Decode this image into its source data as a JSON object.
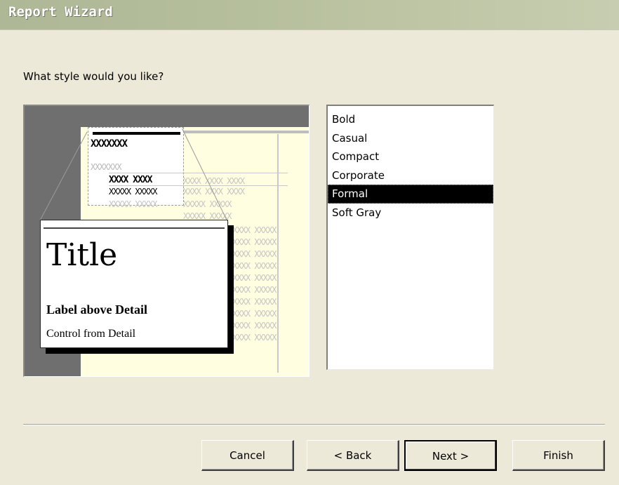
{
  "window": {
    "title": "Report Wizard"
  },
  "prompt": "What style would you like?",
  "preview": {
    "sample_title": "Title",
    "sample_label": "Label above Detail",
    "sample_control": "Control from Detail",
    "placeholder_heading": "XXXXXXX",
    "placeholder_label": "XXXXXXX",
    "placeholder_label2": "XXXX XXXX",
    "placeholder_row": "XXXXX XXXXX",
    "placeholder_faint_row": "XXXX XXXX XXXX",
    "placeholder_col": "XXXXX XXXXX"
  },
  "styles": {
    "items": [
      "Bold",
      "Casual",
      "Compact",
      "Corporate",
      "Formal",
      "Soft Gray"
    ],
    "selected": "Formal"
  },
  "buttons": {
    "cancel": "Cancel",
    "back": "< Back",
    "next": "Next >",
    "finish": "Finish"
  }
}
